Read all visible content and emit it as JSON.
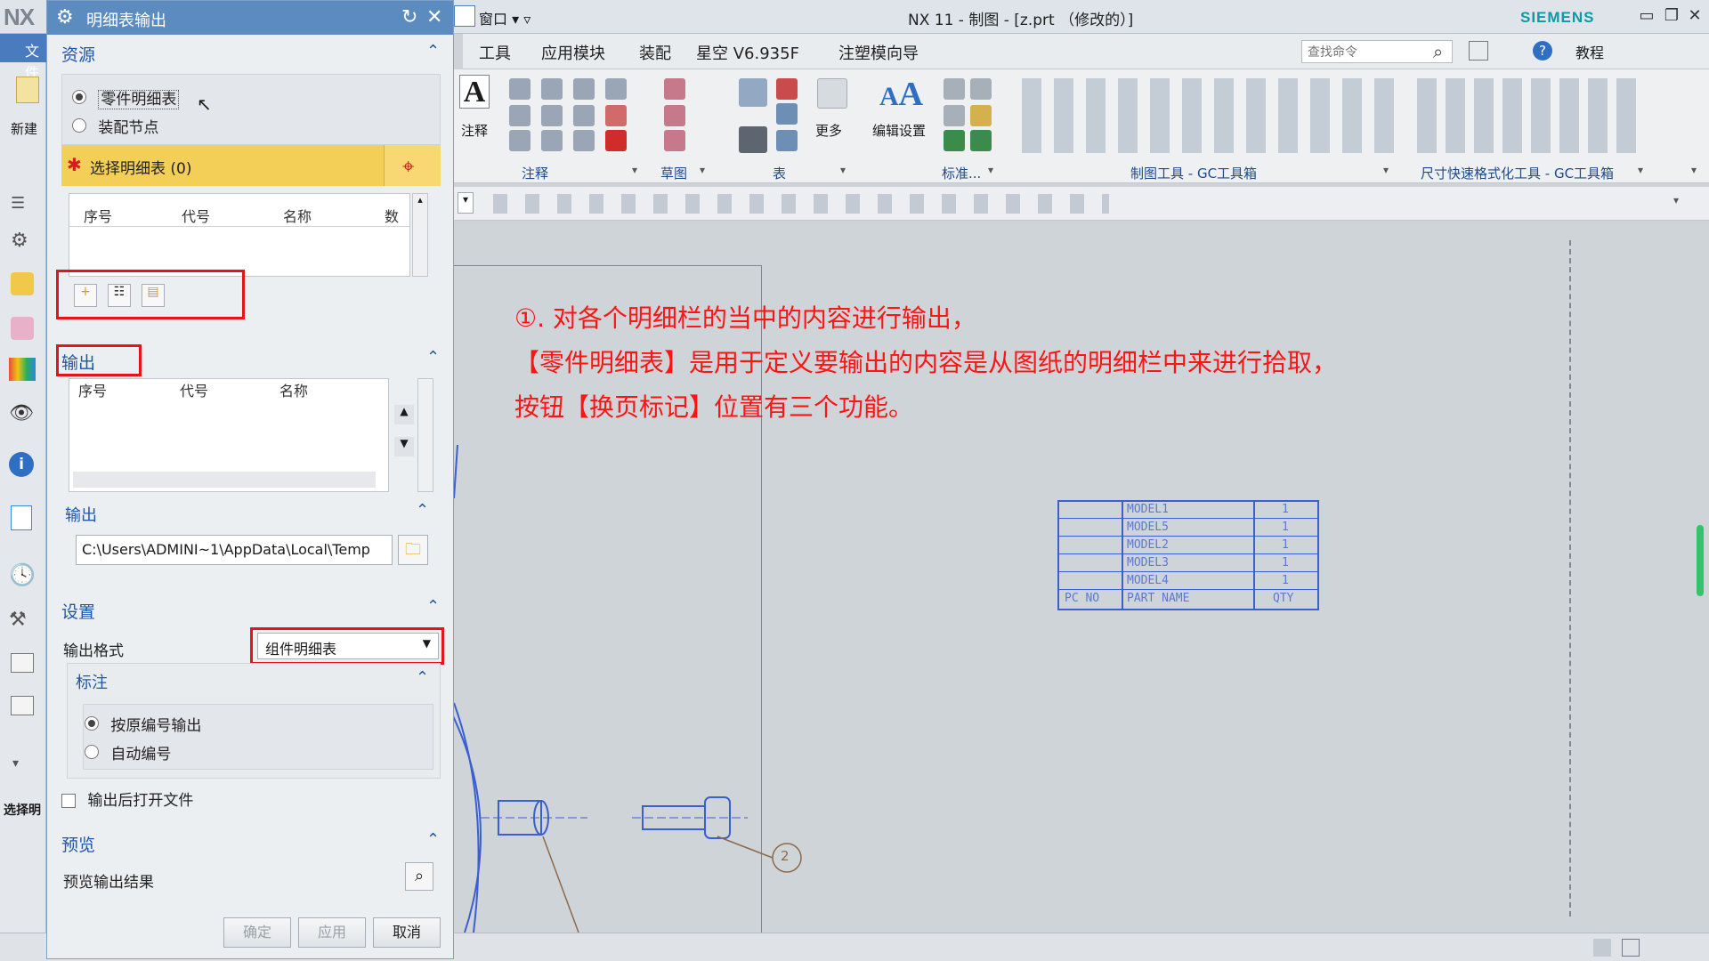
{
  "window": {
    "logo": "NX",
    "title": "NX 11 - 制图 - [z.prt （修改的）]",
    "brand": "SIEMENS",
    "window_menu": "窗口",
    "file_tab": "文件"
  },
  "menubar": {
    "items": [
      "工具",
      "应用模块",
      "装配",
      "星空 V6.935F",
      "注塑模向导"
    ],
    "search_placeholder": "查找命令",
    "tutorial_label": "教程"
  },
  "ribbon": {
    "big_buttons": [
      "注释",
      "更多",
      "编辑设置"
    ],
    "groups": [
      "注释",
      "草图",
      "表",
      "标准...",
      "制图工具 - GC工具箱",
      "尺寸快速格式化工具 - GC工具箱"
    ]
  },
  "left_panel": {
    "new_label": "新建",
    "bottom_label": "选择明"
  },
  "dialog": {
    "title": "明细表输出",
    "source": {
      "heading": "资源",
      "options": [
        "零件明细表",
        "装配节点"
      ],
      "selected": 0,
      "select_label": "选择明细表 (0)",
      "columns": [
        "序号",
        "代号",
        "名称",
        "数"
      ]
    },
    "output": {
      "heading": "输出",
      "columns": [
        "序号",
        "代号",
        "名称"
      ],
      "sub_heading": "输出",
      "path": "C:\\Users\\ADMINI~1\\AppData\\Local\\Temp"
    },
    "settings": {
      "heading": "设置",
      "format_label": "输出格式",
      "format_value": "组件明细表",
      "annotation_heading": "标注",
      "annotation_options": [
        "按原编号输出",
        "自动编号"
      ],
      "annotation_selected": 0,
      "open_after_label": "输出后打开文件",
      "open_after_checked": false
    },
    "preview": {
      "heading": "预览",
      "label": "预览输出结果"
    },
    "buttons": {
      "ok": "确定",
      "apply": "应用",
      "cancel": "取消"
    }
  },
  "annotation": {
    "line1": "①. 对各个明细栏的当中的内容进行输出，",
    "line2": "【零件明细表】是用于定义要输出的内容是从图纸的明细栏中来进行拾取，",
    "line3": "按钮【换页标记】位置有三个功能。"
  },
  "drawing_table": {
    "rows": [
      {
        "pc": "",
        "name": "MODEL1",
        "qty": "1"
      },
      {
        "pc": "",
        "name": "MODEL5",
        "qty": "1"
      },
      {
        "pc": "",
        "name": "MODEL2",
        "qty": "1"
      },
      {
        "pc": "",
        "name": "MODEL3",
        "qty": "1"
      },
      {
        "pc": "",
        "name": "MODEL4",
        "qty": "1"
      }
    ],
    "header": {
      "pc": "PC NO",
      "name": "PART NAME",
      "qty": "QTY"
    }
  },
  "balloon": "2",
  "colors": {
    "accent": "#5b8bbf",
    "annotation_red": "#ff1414",
    "highlight_row": "#f3cf58",
    "table_blue": "#3b5fcf"
  }
}
